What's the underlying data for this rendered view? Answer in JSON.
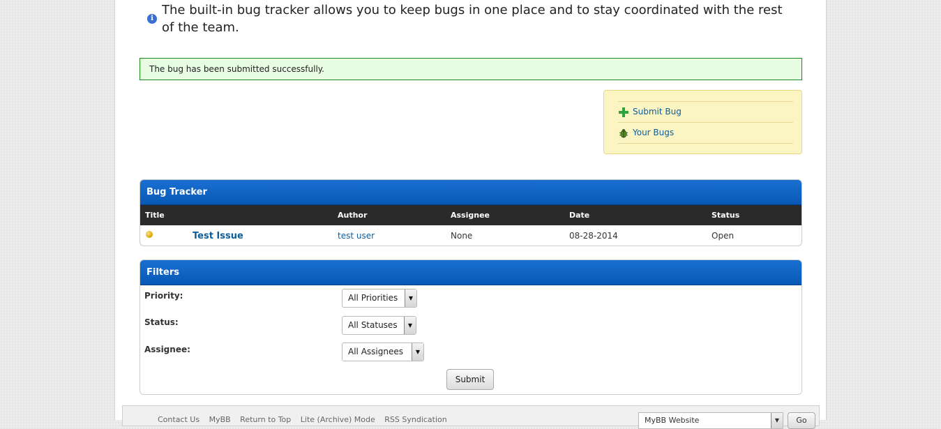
{
  "intro": {
    "text": "The built-in bug tracker allows you to keep bugs in one place and to stay coordinated with the rest of the team."
  },
  "success_message": "The bug has been submitted successfully.",
  "sidebox": {
    "items": [
      {
        "label": "Submit Bug",
        "icon": "plus-icon"
      },
      {
        "label": "Your Bugs",
        "icon": "bug-icon"
      }
    ]
  },
  "bug_tracker": {
    "title": "Bug Tracker",
    "columns": [
      "Title",
      "Author",
      "Assignee",
      "Date",
      "Status"
    ],
    "rows": [
      {
        "priority_icon": "priority-dot-icon",
        "title": "Test Issue",
        "author": "test user",
        "assignee": "None",
        "date": "08-28-2014",
        "status": "Open"
      }
    ]
  },
  "filters": {
    "title": "Filters",
    "priority_label": "Priority:",
    "priority_value": "All Priorities",
    "status_label": "Status:",
    "status_value": "All Statuses",
    "assignee_label": "Assignee:",
    "assignee_value": "All Assignees",
    "submit_label": "Submit"
  },
  "footer": {
    "links": [
      "Contact Us",
      "MyBB",
      "Return to Top",
      "Lite (Archive) Mode",
      "RSS Syndication"
    ],
    "theme_select": "MyBB Website",
    "go_label": "Go"
  },
  "colors": {
    "header_blue": "#0b63c5",
    "success_bg": "#e8fce4",
    "sidebox_bg": "#fbf4c3",
    "link": "#0c5d9c"
  }
}
